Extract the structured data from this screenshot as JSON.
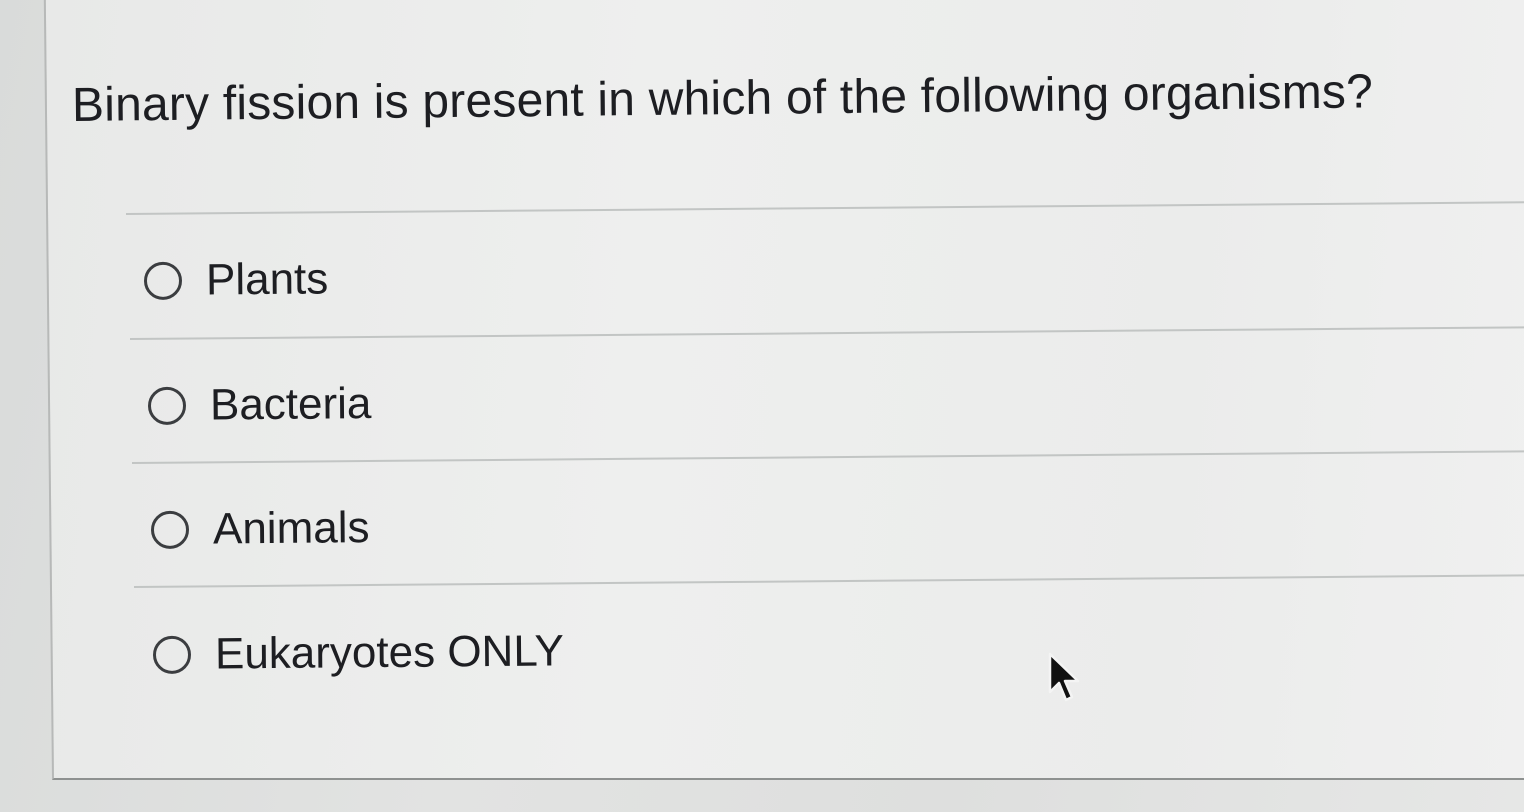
{
  "question": {
    "text": "Binary fission is present in which of the following organisms?"
  },
  "options": [
    {
      "label": "Plants",
      "selected": false
    },
    {
      "label": "Bacteria",
      "selected": false
    },
    {
      "label": "Animals",
      "selected": false
    },
    {
      "label": "Eukaryotes ONLY",
      "selected": false
    }
  ],
  "icons": {
    "radio": "radio-unselected-icon",
    "cursor": "mouse-pointer-icon"
  },
  "colors": {
    "text": "#1d1e22",
    "radio_border": "#3b3d40",
    "divider": "#c2c5c4",
    "card_background": "#eeefee"
  }
}
